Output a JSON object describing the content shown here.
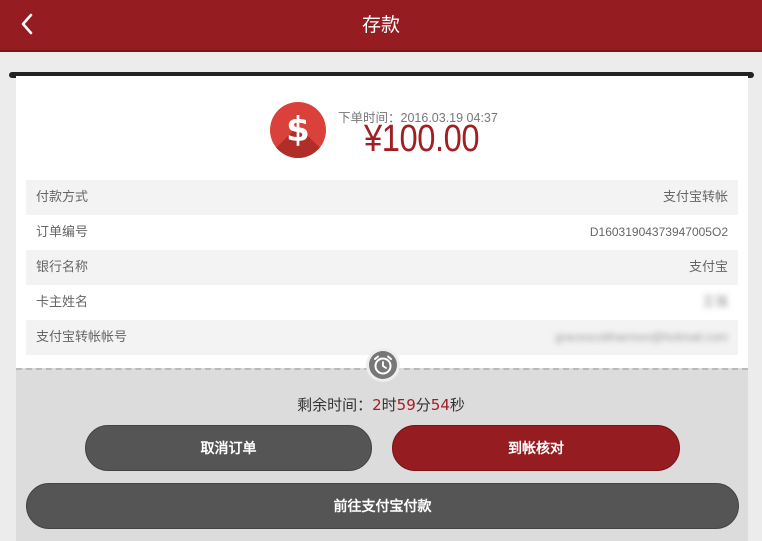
{
  "header": {
    "title": "存款",
    "back_icon": "chevron-left-icon"
  },
  "summary": {
    "icon": "dollar-icon",
    "order_time_label": "下单时间：",
    "order_time": "2016.03.19 04:37",
    "amount": "¥100.00"
  },
  "details": [
    {
      "label": "付款方式",
      "value": "支付宝转帐"
    },
    {
      "label": "订单编号",
      "value": "D16031904373947005O2"
    },
    {
      "label": "银行名称",
      "value": "支付宝"
    },
    {
      "label": "卡主姓名",
      "value": "王强"
    },
    {
      "label": "支付宝转帐帐号",
      "value": "gracescottharmon@hotmail.com"
    }
  ],
  "countdown": {
    "label": "剩余时间：",
    "hours": "2",
    "hours_unit": "时",
    "minutes": "59",
    "minutes_unit": "分",
    "seconds": "54",
    "seconds_unit": "秒",
    "icon": "alarm-clock-icon"
  },
  "actions": {
    "cancel_label": "取消订单",
    "confirm_label": "到帐核对",
    "alipay_label": "前往支付宝付款"
  },
  "colors": {
    "brand": "#951c21",
    "amount": "#a11e25",
    "dark_button": "#555555"
  }
}
